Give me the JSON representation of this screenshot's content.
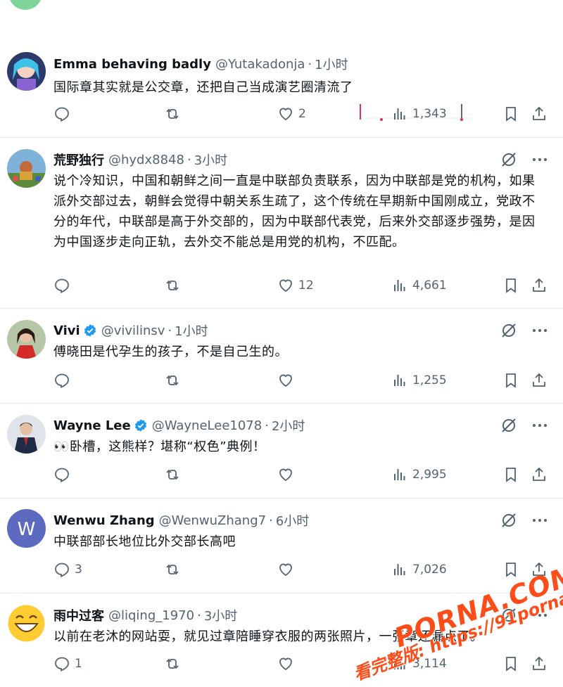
{
  "tweets": [
    {
      "name": "Emma behaving badly",
      "handle": "@Yutakadonja",
      "time": "1小时",
      "text": "国际章其实就是公交章，还把自己当成演艺圈清流了",
      "reply_count": "",
      "retweet_count": "",
      "like_count": "2",
      "view_count": "1,343"
    },
    {
      "name": "荒野独行",
      "handle": "@hydx8848",
      "time": "3小时",
      "text": "说个冷知识，中国和朝鲜之间一直是中联部负责联系，因为中联部是党的机构，如果派外交部过去，朝鲜会觉得中朝关系生疏了，这个传统在早期新中国刚成立，党政不分的年代，中联部是高于外交部的，因为中联部代表党，后来外交部逐步强势，是因为中国逐步走向正轨，去外交不能总是用党的机构，不匹配。",
      "reply_count": "",
      "retweet_count": "",
      "like_count": "12",
      "view_count": "4,661"
    },
    {
      "name": "Vivi",
      "handle": "@vivilinsv",
      "time": "1小时",
      "text": "傅晓田是代孕生的孩子，不是自己生的。",
      "reply_count": "",
      "retweet_count": "",
      "like_count": "",
      "view_count": "1,255"
    },
    {
      "name": "Wayne Lee",
      "handle": "@WayneLee1078",
      "time": "2小时",
      "text": "👀卧槽，这熊样？堪称“权色”典例！",
      "reply_count": "",
      "retweet_count": "",
      "like_count": "",
      "view_count": "2,995"
    },
    {
      "name": "Wenwu Zhang",
      "handle": "@WenwuZhang7",
      "time": "6小时",
      "text": "中联部部长地位比外交部长高吧",
      "avatar_letter": "W",
      "reply_count": "3",
      "retweet_count": "",
      "like_count": "",
      "view_count": "7,026"
    },
    {
      "name": "雨中过客",
      "handle": "@liqing_1970",
      "time": "3小时",
      "text": "以前在老沐的网站耍，就见过章陪睡穿衣服的两张照片，一张章还漏点了。",
      "reply_count": "1",
      "retweet_count": "",
      "like_count": "",
      "view_count": "3,114"
    }
  ],
  "watermark": {
    "brand": "PORNA.COM",
    "url_line": "看完整版: https://91porna69.com"
  },
  "colors": {
    "text": "#0f1419",
    "muted": "#536471",
    "verified": "#1d9bf0",
    "wenwu_avatar": "#5c6bc0",
    "watermark": "#ff4d1a"
  }
}
